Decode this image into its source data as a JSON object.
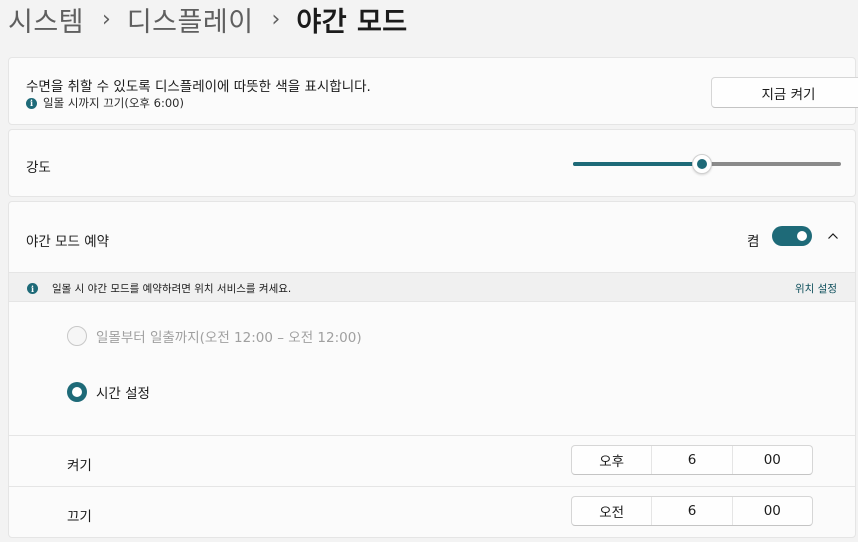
{
  "breadcrumb": {
    "items": [
      "시스템",
      "디스플레이"
    ],
    "separator": "›",
    "current": "야간 모드"
  },
  "status_card": {
    "description": "수면을 취할 수 있도록 디스플레이에 따뜻한 색을 표시합니다.",
    "status": "일몰 시까지 끄기(오후 6:00)",
    "turn_on_now_label": "지금 켜기"
  },
  "strength": {
    "label": "강도",
    "value_fraction": 0.48
  },
  "schedule": {
    "label": "야간 모드 예약",
    "toggle_state_label": "켬",
    "toggle_on": true,
    "info_text": "일몰 시 야간 모드를 예약하려면 위치 서비스를 켜세요.",
    "info_link": "위치 설정",
    "options": {
      "sunset_to_sunrise": "일몰부터 일출까지(오전 12:00 – 오전 12:00)",
      "set_hours": "시간 설정"
    },
    "turn_on": {
      "label": "켜기",
      "period": "오후",
      "hour": "6",
      "minute": "00"
    },
    "turn_off": {
      "label": "끄기",
      "period": "오전",
      "hour": "6",
      "minute": "00"
    }
  },
  "colors": {
    "accent": "#1e6a78",
    "background": "#f3f3f3",
    "card": "#fbfbfb"
  }
}
